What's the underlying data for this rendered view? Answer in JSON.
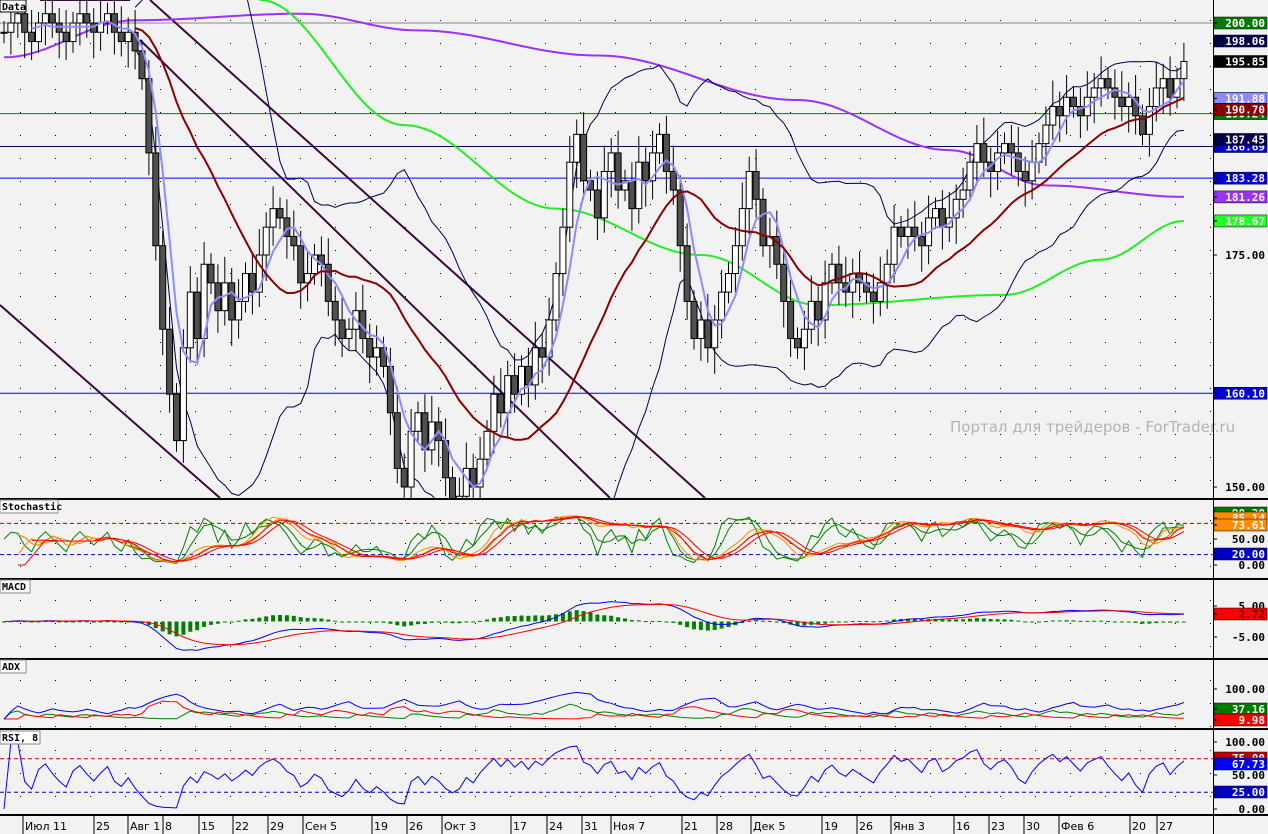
{
  "panels": {
    "main_title": "Data",
    "stochastic_title": "Stochastic",
    "macd_title": "MACD",
    "adx_title": "ADX",
    "rsi_title": "RSI, 8"
  },
  "watermark": "Портал для трейдеров - ForTrader.ru",
  "colors": {
    "background": "#f2f2f2",
    "bear_candle": "#505050",
    "bull_candle": "#ffffff",
    "sma_fast": "#8c8cff",
    "sma_mid": "#8b0000",
    "bollinger": "#000050",
    "ma_purple": "#9b30ff",
    "ma_green": "#22ee22",
    "channel": "#3a0a3a"
  },
  "chart_data": {
    "type": "candlestick",
    "x_tick_labels": [
      "Июл 11",
      "25",
      "Авг 1",
      "8",
      "15",
      "22",
      "29",
      "Сен 5",
      "19",
      "26",
      "Окт 3",
      "17",
      "24",
      "31",
      "Ноя 7",
      "21",
      "28",
      "Дек 5",
      "19",
      "26",
      "Янв 3",
      "16",
      "23",
      "30",
      "Фев 6",
      "20",
      "27"
    ],
    "y_range": [
      148,
      202
    ],
    "y_tick_labels": [
      "175.00",
      "150.00"
    ],
    "close": [
      199,
      200,
      201,
      199,
      198,
      200,
      201,
      200,
      199,
      198,
      200,
      201,
      200,
      199,
      200,
      201,
      199,
      198,
      199,
      197,
      194,
      186,
      176,
      167,
      160,
      155,
      165,
      171,
      166,
      174,
      172,
      169,
      172,
      168,
      170,
      173,
      171,
      175,
      178,
      180,
      179,
      177,
      176,
      172,
      173,
      175,
      174,
      170,
      168,
      166,
      167,
      169,
      166,
      164,
      165,
      163,
      158,
      152,
      150,
      156,
      158,
      154,
      157,
      155,
      151,
      148,
      149,
      152,
      150,
      153,
      156,
      160,
      158,
      162,
      160,
      163,
      161,
      165,
      164,
      168,
      173,
      178,
      185,
      188,
      183,
      182,
      179,
      184,
      186,
      182,
      183,
      180,
      185,
      183,
      186,
      188,
      184,
      182,
      176,
      170,
      166,
      168,
      165,
      168,
      171,
      173,
      176,
      180,
      184,
      181,
      176,
      177,
      174,
      170,
      166,
      165,
      167,
      170,
      168,
      172,
      174,
      172,
      171,
      173,
      172,
      171,
      170,
      172,
      174,
      178,
      177,
      178,
      177,
      176,
      179,
      180,
      178,
      179,
      181,
      182,
      185,
      187,
      185,
      184,
      186,
      187,
      186,
      184,
      183,
      185,
      187,
      189,
      191,
      190,
      192,
      191,
      190,
      192,
      193,
      194,
      193,
      192,
      191,
      192,
      190,
      188,
      191,
      193,
      194,
      192,
      194,
      195.85
    ],
    "ma_purple_points": [
      [
        0,
        196.3
      ],
      [
        19,
        200.3
      ],
      [
        43,
        201
      ],
      [
        60,
        199.2
      ],
      [
        86,
        196.5
      ],
      [
        115,
        191.7
      ],
      [
        137,
        186.3
      ],
      [
        151,
        182.5
      ],
      [
        171,
        181.26
      ]
    ],
    "ma_green_points": [
      [
        37,
        202.5
      ],
      [
        58,
        189
      ],
      [
        80,
        180
      ],
      [
        101,
        175
      ],
      [
        118,
        169.6
      ],
      [
        145,
        170.7
      ],
      [
        159,
        174.5
      ],
      [
        171,
        178.67
      ]
    ],
    "horizontal_levels": [
      {
        "value": 200.0,
        "label": "200.00",
        "color": "#888888",
        "tag_bg": "#007a00",
        "tag_fg": "#ffffff"
      },
      {
        "value": 190.24,
        "label": "190.24",
        "color": "#008000",
        "tag_bg": "#007a00",
        "tag_fg": "#ffffff"
      },
      {
        "value": 186.69,
        "label": "186.69",
        "color": "#000060",
        "tag_bg": "#0000d0",
        "tag_fg": "#ffffff"
      },
      {
        "value": 183.28,
        "label": "183.28",
        "color": "#0000ff",
        "tag_bg": "#0000d0",
        "tag_fg": "#ffffff"
      },
      {
        "value": 160.1,
        "label": "160.10",
        "color": "#0000ff",
        "tag_bg": "#0000d0",
        "tag_fg": "#ffffff"
      }
    ],
    "price_tags": [
      {
        "value": 198.06,
        "label": "198.06",
        "bg": "#00004a",
        "fg": "#ffffff"
      },
      {
        "value": 195.85,
        "label": "195.85",
        "bg": "#000000",
        "fg": "#ffffff"
      },
      {
        "value": 191.88,
        "label": "191.88",
        "bg": "#8c8cff",
        "fg": "#ffffff"
      },
      {
        "value": 190.7,
        "label": "190.70",
        "bg": "#8b0000",
        "fg": "#ffffff"
      },
      {
        "value": 187.45,
        "label": "187.45",
        "bg": "#00004a",
        "fg": "#ffffff"
      },
      {
        "value": 181.26,
        "label": "181.26",
        "bg": "#9b30ff",
        "fg": "#ffffff"
      },
      {
        "value": 178.67,
        "label": "178.67",
        "bg": "#22ff22",
        "fg": "#ffffff"
      }
    ],
    "stochastic": {
      "axis_labels": [
        "50.00",
        "0.00"
      ],
      "levels": [
        80,
        20
      ],
      "tags": [
        {
          "label": "90.20",
          "bg": "#007a00"
        },
        {
          "label": "85.14",
          "bg": "#ff8c00"
        },
        {
          "label": "73.61",
          "bg": "#ff8c00"
        },
        {
          "label": "20.00",
          "bg": "#0000c0"
        }
      ]
    },
    "macd": {
      "axis_labels": [
        "5.00",
        "-5.00"
      ],
      "tags": [
        {
          "label": "2.72",
          "bg": "#ff0000"
        }
      ]
    },
    "adx": {
      "axis_labels": [
        "100.00"
      ],
      "tags": [
        {
          "label": "37.16",
          "bg": "#007a00"
        },
        {
          "label": "9.98",
          "bg": "#ff0000"
        }
      ]
    },
    "rsi": {
      "period": 8,
      "axis_labels": [
        "100.00",
        "50.00",
        "0.00"
      ],
      "levels": [
        75,
        25
      ],
      "tags": [
        {
          "label": "75.00",
          "bg": "#c00000"
        },
        {
          "label": "67.73",
          "bg": "#0000ff"
        },
        {
          "label": "25.00",
          "bg": "#0000c0"
        }
      ]
    }
  }
}
